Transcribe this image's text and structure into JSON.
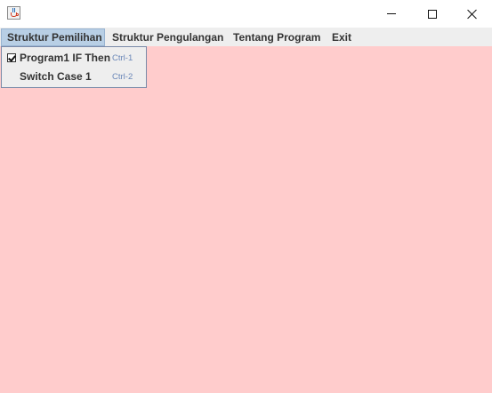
{
  "window": {
    "icon": "java-cup-icon",
    "controls": [
      "minimize-icon",
      "maximize-icon",
      "close-icon"
    ]
  },
  "menubar": {
    "items": [
      {
        "label": "Struktur Pemilihan",
        "active": true
      },
      {
        "label": "Struktur Pengulangan"
      },
      {
        "label": "Tentang Program"
      },
      {
        "label": "Exit"
      }
    ]
  },
  "dropdown": {
    "items": [
      {
        "label": "Program1 IF Then",
        "shortcut": "Ctrl-1",
        "checked": true
      },
      {
        "label": "Switch Case 1",
        "shortcut": "Ctrl-2",
        "checked": false
      }
    ]
  },
  "colors": {
    "content_background": "#ffcccc",
    "menu_active": "#b8cfe5",
    "shortcut_text": "#6a87b8"
  }
}
